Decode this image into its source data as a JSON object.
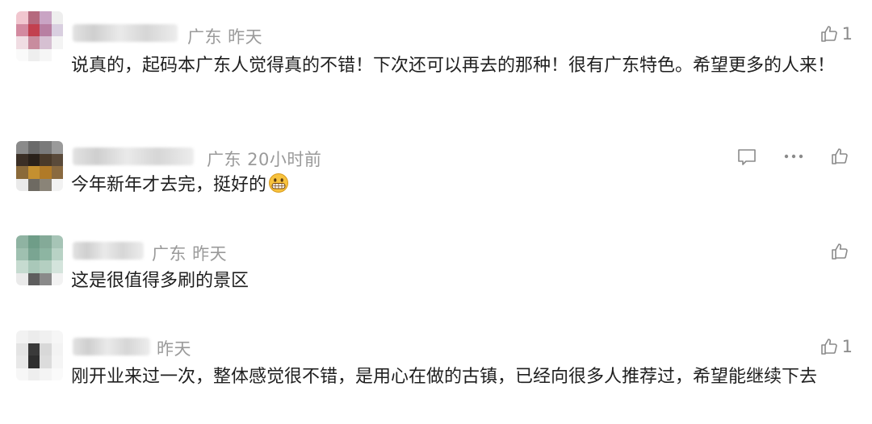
{
  "comments": [
    {
      "meta": "广东  昨天",
      "text": "说真的，起码本广东人觉得真的不错！下次还可以再去的那种！很有广东特色。希望更多的人来！",
      "likes": "1"
    },
    {
      "meta": "广东  20小时前",
      "text": "今年新年才去完，挺好的",
      "likes": ""
    },
    {
      "meta": "广东  昨天",
      "text": "这是很值得多刷的景区",
      "likes": ""
    },
    {
      "meta": "昨天",
      "text": "刚开业来过一次，整体感觉很不错，是用心在做的古镇，已经向很多人推荐过，希望能继续下去",
      "likes": "1"
    }
  ],
  "icons": {
    "like": "thumbs-up-icon",
    "reply": "comment-icon",
    "more": "more-icon",
    "emoji": "grinning-emoji-icon"
  }
}
